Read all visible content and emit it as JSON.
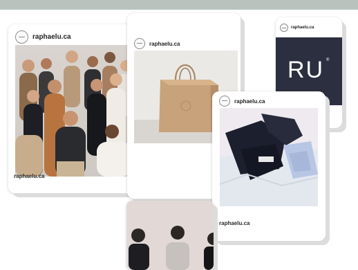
{
  "colors": {
    "page_background": "#ffffff",
    "top_strip": "#b9c2bd",
    "card_background": "#ffffff",
    "card_shadow": "#dcdcdc",
    "brand_tile": "#2b2f3f",
    "brand_mark_text": "#ffffff"
  },
  "cards": {
    "team_post": {
      "handle": "raphaelu.ca",
      "footer": "raphaelu.ca",
      "image": "team-group-photo"
    },
    "bag_post": {
      "handle": "raphaelu.ca",
      "image": "paper-shopping-bag-photo"
    },
    "brand_post": {
      "handle": "raphaelu.ca",
      "mark": "RU",
      "trademark": "®"
    },
    "clothing_post": {
      "handle": "raphaelu.ca",
      "footer": "raphaelu.ca",
      "image": "folded-clothing-photo"
    },
    "people_post": {
      "image": "three-people-photo"
    }
  }
}
